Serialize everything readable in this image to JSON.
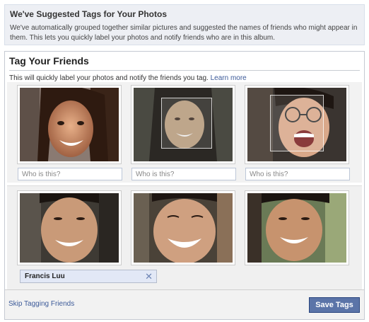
{
  "banner": {
    "title": "We've Suggested Tags for Your Photos",
    "text": "We've automatically grouped together similar pictures and suggested the names of friends who might appear in them. This lets you quickly label your photos and notify friends who are in this album."
  },
  "panel": {
    "title": "Tag Your Friends",
    "subtitle": "This will quickly label your photos and notify the friends you tag.",
    "learn_more": "Learn more"
  },
  "group1": {
    "inputs": [
      {
        "placeholder": "Who is this?"
      },
      {
        "placeholder": "Who is this?"
      },
      {
        "placeholder": "Who is this?"
      }
    ]
  },
  "group2": {
    "tagged_name": "Francis Luu",
    "remove_icon": "close-icon"
  },
  "footer": {
    "skip_label": "Skip Tagging Friends",
    "save_label": "Save Tags"
  },
  "colors": {
    "link": "#3b5998",
    "button_bg": "#5b74a8",
    "banner_bg": "#edeff4",
    "tag_token_bg": "#e2e8f6"
  }
}
